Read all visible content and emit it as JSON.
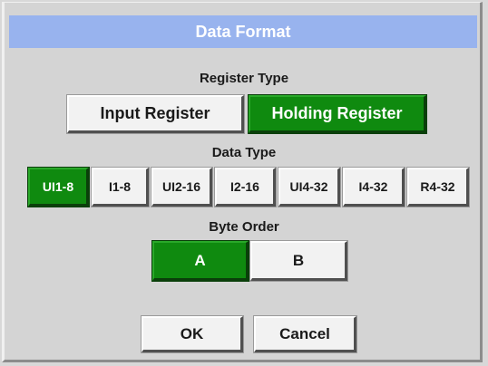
{
  "dialog": {
    "title": "Data Format"
  },
  "register_type": {
    "label": "Register Type",
    "options": [
      "Input Register",
      "Holding Register"
    ],
    "selected": "Holding Register"
  },
  "data_type": {
    "label": "Data Type",
    "options": [
      "UI1-8",
      "I1-8",
      "UI2-16",
      "I2-16",
      "UI4-32",
      "I4-32",
      "R4-32"
    ],
    "selected": "UI1-8"
  },
  "byte_order": {
    "label": "Byte Order",
    "options": [
      "A",
      "B"
    ],
    "selected": "A"
  },
  "actions": {
    "ok_label": "OK",
    "cancel_label": "Cancel"
  },
  "colors": {
    "title_bar": "#98b3ee",
    "selected": "#0f8a0f",
    "panel": "#d4d4d4"
  }
}
